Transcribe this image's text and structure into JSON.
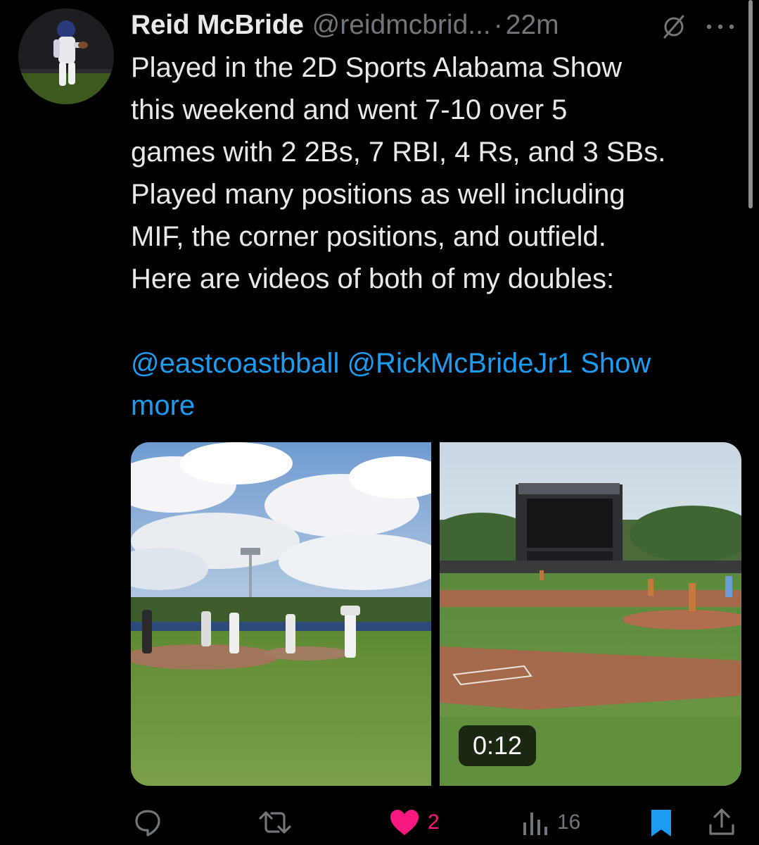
{
  "tweet": {
    "author_name": "Reid McBride",
    "handle": "@reidmcbrid...",
    "separator": "·",
    "time": "22m",
    "body_lines": [
      "Played in the 2D Sports Alabama Show",
      "this weekend and went 7-10 over 5",
      "games with 2 2Bs, 7 RBI, 4 Rs, and 3 SBs.",
      "Played many positions as well including",
      "MIF, the corner positions, and outfield.",
      "Here are videos of both of my doubles:"
    ],
    "mention_1": "@eastcoastbball",
    "mention_2": "@RickMcBrideJr1",
    "show_more": "Show",
    "show_more_2": "more",
    "video_duration": "0:12"
  },
  "actions": {
    "reply_icon": "reply-icon",
    "retweet_icon": "retweet-icon",
    "like_icon": "heart-icon",
    "like_count": "2",
    "views_icon": "views-icon",
    "views_count": "16",
    "bookmark_icon": "bookmark-icon",
    "share_icon": "share-icon"
  },
  "colors": {
    "background": "#000000",
    "text": "#e7e9ea",
    "secondary": "#71767b",
    "link": "#1d9bf0",
    "like": "#f91880",
    "bookmark": "#1d9bf0"
  }
}
